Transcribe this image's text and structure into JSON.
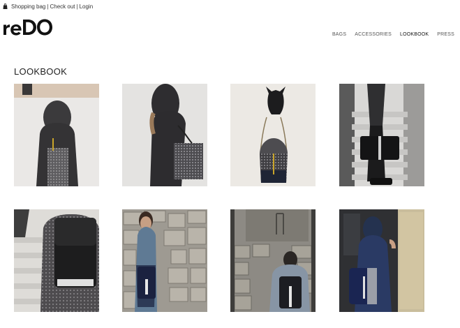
{
  "topbar": {
    "bag_icon": "shopping-bag-icon",
    "links": [
      "Shopping bag",
      "Check out",
      "Login"
    ]
  },
  "logo": {
    "text": "reDO"
  },
  "nav": {
    "items": [
      "BAGS",
      "ACCESSORIES",
      "LOOKBOOK",
      "PRESS"
    ],
    "active": "LOOKBOOK"
  },
  "page": {
    "title": "LOOKBOOK"
  },
  "gallery": {
    "items": [
      {
        "subject": "hooded figure from behind wearing tweed backpack"
      },
      {
        "subject": "hooded figure side view with tweed backpack"
      },
      {
        "subject": "bucket bag hanging on dark horse-head hook"
      },
      {
        "subject": "person on white stairs holding black leather bag"
      },
      {
        "subject": "person in grey coat wearing black backpack on stairs"
      },
      {
        "subject": "woman by stone wall with navy bag"
      },
      {
        "subject": "person from behind at stone wall with backpack"
      },
      {
        "subject": "hooded figure in blue coat with navy bag at doorway"
      }
    ]
  },
  "colors": {
    "accent": "#111111",
    "nav": "#555555"
  }
}
